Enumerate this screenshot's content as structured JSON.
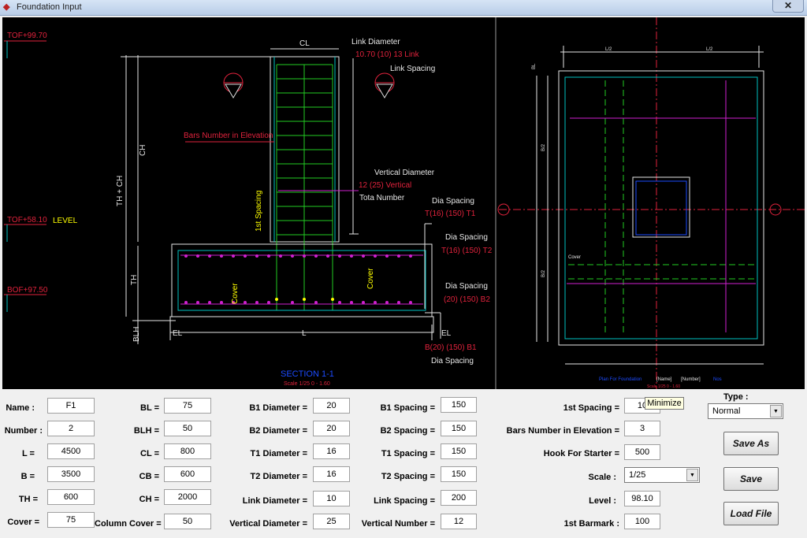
{
  "window": {
    "title": "Foundation Input",
    "close_label": "✕",
    "tooltip": "Minimize"
  },
  "drawing": {
    "levels": {
      "tof_top": "TOF+99.70",
      "tof_mid": "TOF+58.10",
      "level_word": "LEVEL",
      "bof": "BOF+97.50"
    },
    "dims": {
      "cl": "CL",
      "ch": "CH",
      "th_ch": "TH + CH",
      "th": "TH",
      "blh": "BLH",
      "el_left": "EL",
      "l": "L",
      "el_right": "EL"
    },
    "annotations": {
      "link_diameter": "Link Diameter",
      "link_marks": "10.70 (10) 13 Link",
      "link_spacing": "Link Spacing",
      "bars_elevation": "Bars Number in Elevation",
      "first_spacing": "1st Spacing",
      "vertical_diameter": "Vertical Diameter",
      "vertical_marks": "12 (25) Vertical",
      "total_number": "Tota Number",
      "dia_spacing_1": "Dia  Spacing",
      "t1_marks": "T(16) (150) T1",
      "dia_spacing_2": "Dia  Spacing",
      "t2_marks": "T(16) (150) T2",
      "dia_spacing_3": "Dia  Spacing",
      "b2_marks": "(20) (150) B2",
      "b1_marks": "B(20) (150) B1",
      "dia_spacing_4": "Dia  Spacing",
      "cover_left": "Cover",
      "cover_right": "Cover",
      "section_title": "SECTION 1-1",
      "section_scale": "Scale 1/25 0 - 1.60"
    },
    "plan": {
      "top_dim_left": "L/2",
      "top_dim_right": "L/2",
      "left_dim_top": "B/2",
      "left_dim_bottom": "B/2",
      "bl_label": "BL",
      "cover_label": "Cover",
      "title_prefix": "Plan For Foundation",
      "title_name": "[Name]",
      "title_number": "[Number]",
      "title_suffix": "Nos",
      "scale_text": "Scale 1/25 0 - 1.60"
    }
  },
  "form": {
    "col1": [
      {
        "label": "Name :",
        "value": "F1"
      },
      {
        "label": "Number :",
        "value": "2"
      },
      {
        "label": "L =",
        "value": "4500"
      },
      {
        "label": "B =",
        "value": "3500"
      },
      {
        "label": "TH =",
        "value": "600"
      },
      {
        "label": "Cover =",
        "value": "75"
      }
    ],
    "col2": [
      {
        "label": "BL =",
        "value": "75"
      },
      {
        "label": "BLH =",
        "value": "50"
      },
      {
        "label": "CL =",
        "value": "800"
      },
      {
        "label": "CB =",
        "value": "600"
      },
      {
        "label": "CH =",
        "value": "2000"
      },
      {
        "label": "Column Cover =",
        "value": "50"
      }
    ],
    "col3": [
      {
        "label": "B1 Diameter =",
        "value": "20"
      },
      {
        "label": "B2 Diameter =",
        "value": "20"
      },
      {
        "label": "T1 Diameter =",
        "value": "16"
      },
      {
        "label": "T2 Diameter =",
        "value": "16"
      },
      {
        "label": "Link Diameter =",
        "value": "10"
      },
      {
        "label": "Vertical Diameter =",
        "value": "25"
      }
    ],
    "col4": [
      {
        "label": "B1 Spacing =",
        "value": "150"
      },
      {
        "label": "B2 Spacing =",
        "value": "150"
      },
      {
        "label": "T1 Spacing =",
        "value": "150"
      },
      {
        "label": "T2 Spacing =",
        "value": "150"
      },
      {
        "label": "Link Spacing =",
        "value": "200"
      },
      {
        "label": "Vertical Number =",
        "value": "12"
      }
    ],
    "col5": [
      {
        "label": "1st Spacing =",
        "value": "10"
      },
      {
        "label": "Bars Number in Elevation =",
        "value": "3"
      },
      {
        "label": "Hook For Starter =",
        "value": "500"
      },
      {
        "label": "Scale :",
        "value": "1/25"
      },
      {
        "label": "Level :",
        "value": "98.10"
      },
      {
        "label": "1st Barmark :",
        "value": "100"
      }
    ],
    "type_label": "Type :",
    "type_value": "Normal",
    "buttons": {
      "save_as": "Save As",
      "save": "Save",
      "load_file": "Load File"
    }
  }
}
